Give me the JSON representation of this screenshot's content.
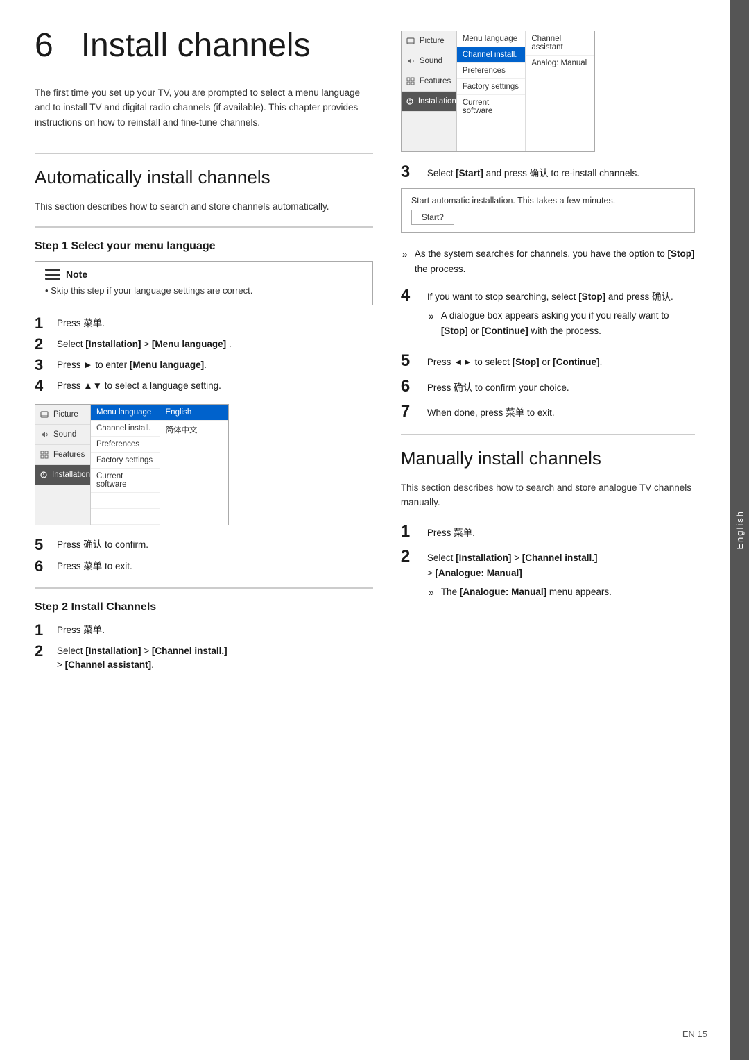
{
  "page": {
    "tab_label": "English",
    "footer": "EN  15"
  },
  "chapter": {
    "number": "6",
    "title": "Install channels"
  },
  "intro": {
    "text": "The first time you set up your TV, you are prompted to select a menu language and to install TV and digital radio channels (if available). This chapter provides instructions on how to reinstall and fine-tune channels."
  },
  "auto_install": {
    "heading": "Automatically install channels",
    "text": "This section describes how to search and store channels automatically."
  },
  "step1": {
    "heading": "Step 1 Select your menu language",
    "note_title": "Note",
    "note_text": "Skip this step if your language settings are correct.",
    "steps": [
      {
        "num": "1",
        "text": "Press 菜单."
      },
      {
        "num": "2",
        "text": "Select [Installation] > [Menu language] ."
      },
      {
        "num": "3",
        "text": "Press ► to enter [Menu language]."
      },
      {
        "num": "4",
        "text": "Press ▲▼ to select a language setting."
      }
    ],
    "step5": "Press 确认 to confirm.",
    "step6": "Press 菜单 to exit."
  },
  "step2": {
    "heading": "Step 2 Install Channels",
    "steps": [
      {
        "num": "1",
        "text": "Press 菜单."
      },
      {
        "num": "2",
        "text": "Select [Installation] > [Channel install.] > [Channel assistant]."
      }
    ]
  },
  "tv_menu_left": {
    "sidebar": [
      {
        "label": "Picture",
        "icon": "picture"
      },
      {
        "label": "Sound",
        "icon": "sound",
        "active": true
      },
      {
        "label": "Features",
        "icon": "features"
      },
      {
        "label": "Installation",
        "icon": "installation"
      }
    ],
    "menu_items": [
      {
        "label": "Menu language",
        "highlighted": true
      },
      {
        "label": "Channel install."
      },
      {
        "label": "Preferences"
      },
      {
        "label": "Factory settings"
      },
      {
        "label": "Current software"
      },
      {
        "label": ""
      },
      {
        "label": ""
      }
    ],
    "sub_items": [
      {
        "label": "English",
        "highlighted": true
      },
      {
        "label": "简体中文"
      }
    ]
  },
  "right_col": {
    "step3_text": "Select [Start] and press 确认 to re-install channels.",
    "dialog_text": "Start automatic installation. This takes a few minutes.",
    "dialog_button": "Start?",
    "bullet1": "As the system searches for channels, you have the option to [Stop] the process.",
    "step4_text": "If you want to stop searching, select [Stop] and press 确认.",
    "bullet2": "A dialogue box appears asking you if you really want to [Stop] or [Continue] with the process.",
    "step5_text": "Press ◄► to select [Stop] or [Continue].",
    "step6_text": "Press 确认 to confirm your choice.",
    "step7_text": "When done, press 菜单 to exit."
  },
  "tv_menu_right": {
    "sidebar": [
      {
        "label": "Picture",
        "icon": "picture"
      },
      {
        "label": "Sound",
        "icon": "sound"
      },
      {
        "label": "Features",
        "icon": "features"
      },
      {
        "label": "Installation",
        "icon": "installation",
        "active": true
      }
    ],
    "menu_items": [
      {
        "label": "Menu language"
      },
      {
        "label": "Channel install.",
        "highlighted": true
      },
      {
        "label": "Preferences"
      },
      {
        "label": "Factory settings"
      },
      {
        "label": "Current software"
      },
      {
        "label": ""
      },
      {
        "label": ""
      }
    ],
    "sub_items": [
      {
        "label": "Channel assistant",
        "highlighted": false
      },
      {
        "label": "Analog: Manual"
      }
    ],
    "top_sub": [
      {
        "label": "Menu language"
      },
      {
        "label": "Channel install.",
        "highlighted": true
      }
    ],
    "top_sub2": [
      {
        "label": "Channel assistant"
      },
      {
        "label": "Analog: Manual"
      }
    ]
  },
  "manually": {
    "heading": "Manually install channels",
    "text": "This section describes how to search and store analogue TV channels manually.",
    "steps": [
      {
        "num": "1",
        "text": "Press 菜单."
      },
      {
        "num": "2",
        "text": "Select [Installation] > [Channel install.] > [Analogue: Manual]"
      },
      {
        "bullet": "The [Analogue: Manual] menu appears."
      }
    ]
  }
}
